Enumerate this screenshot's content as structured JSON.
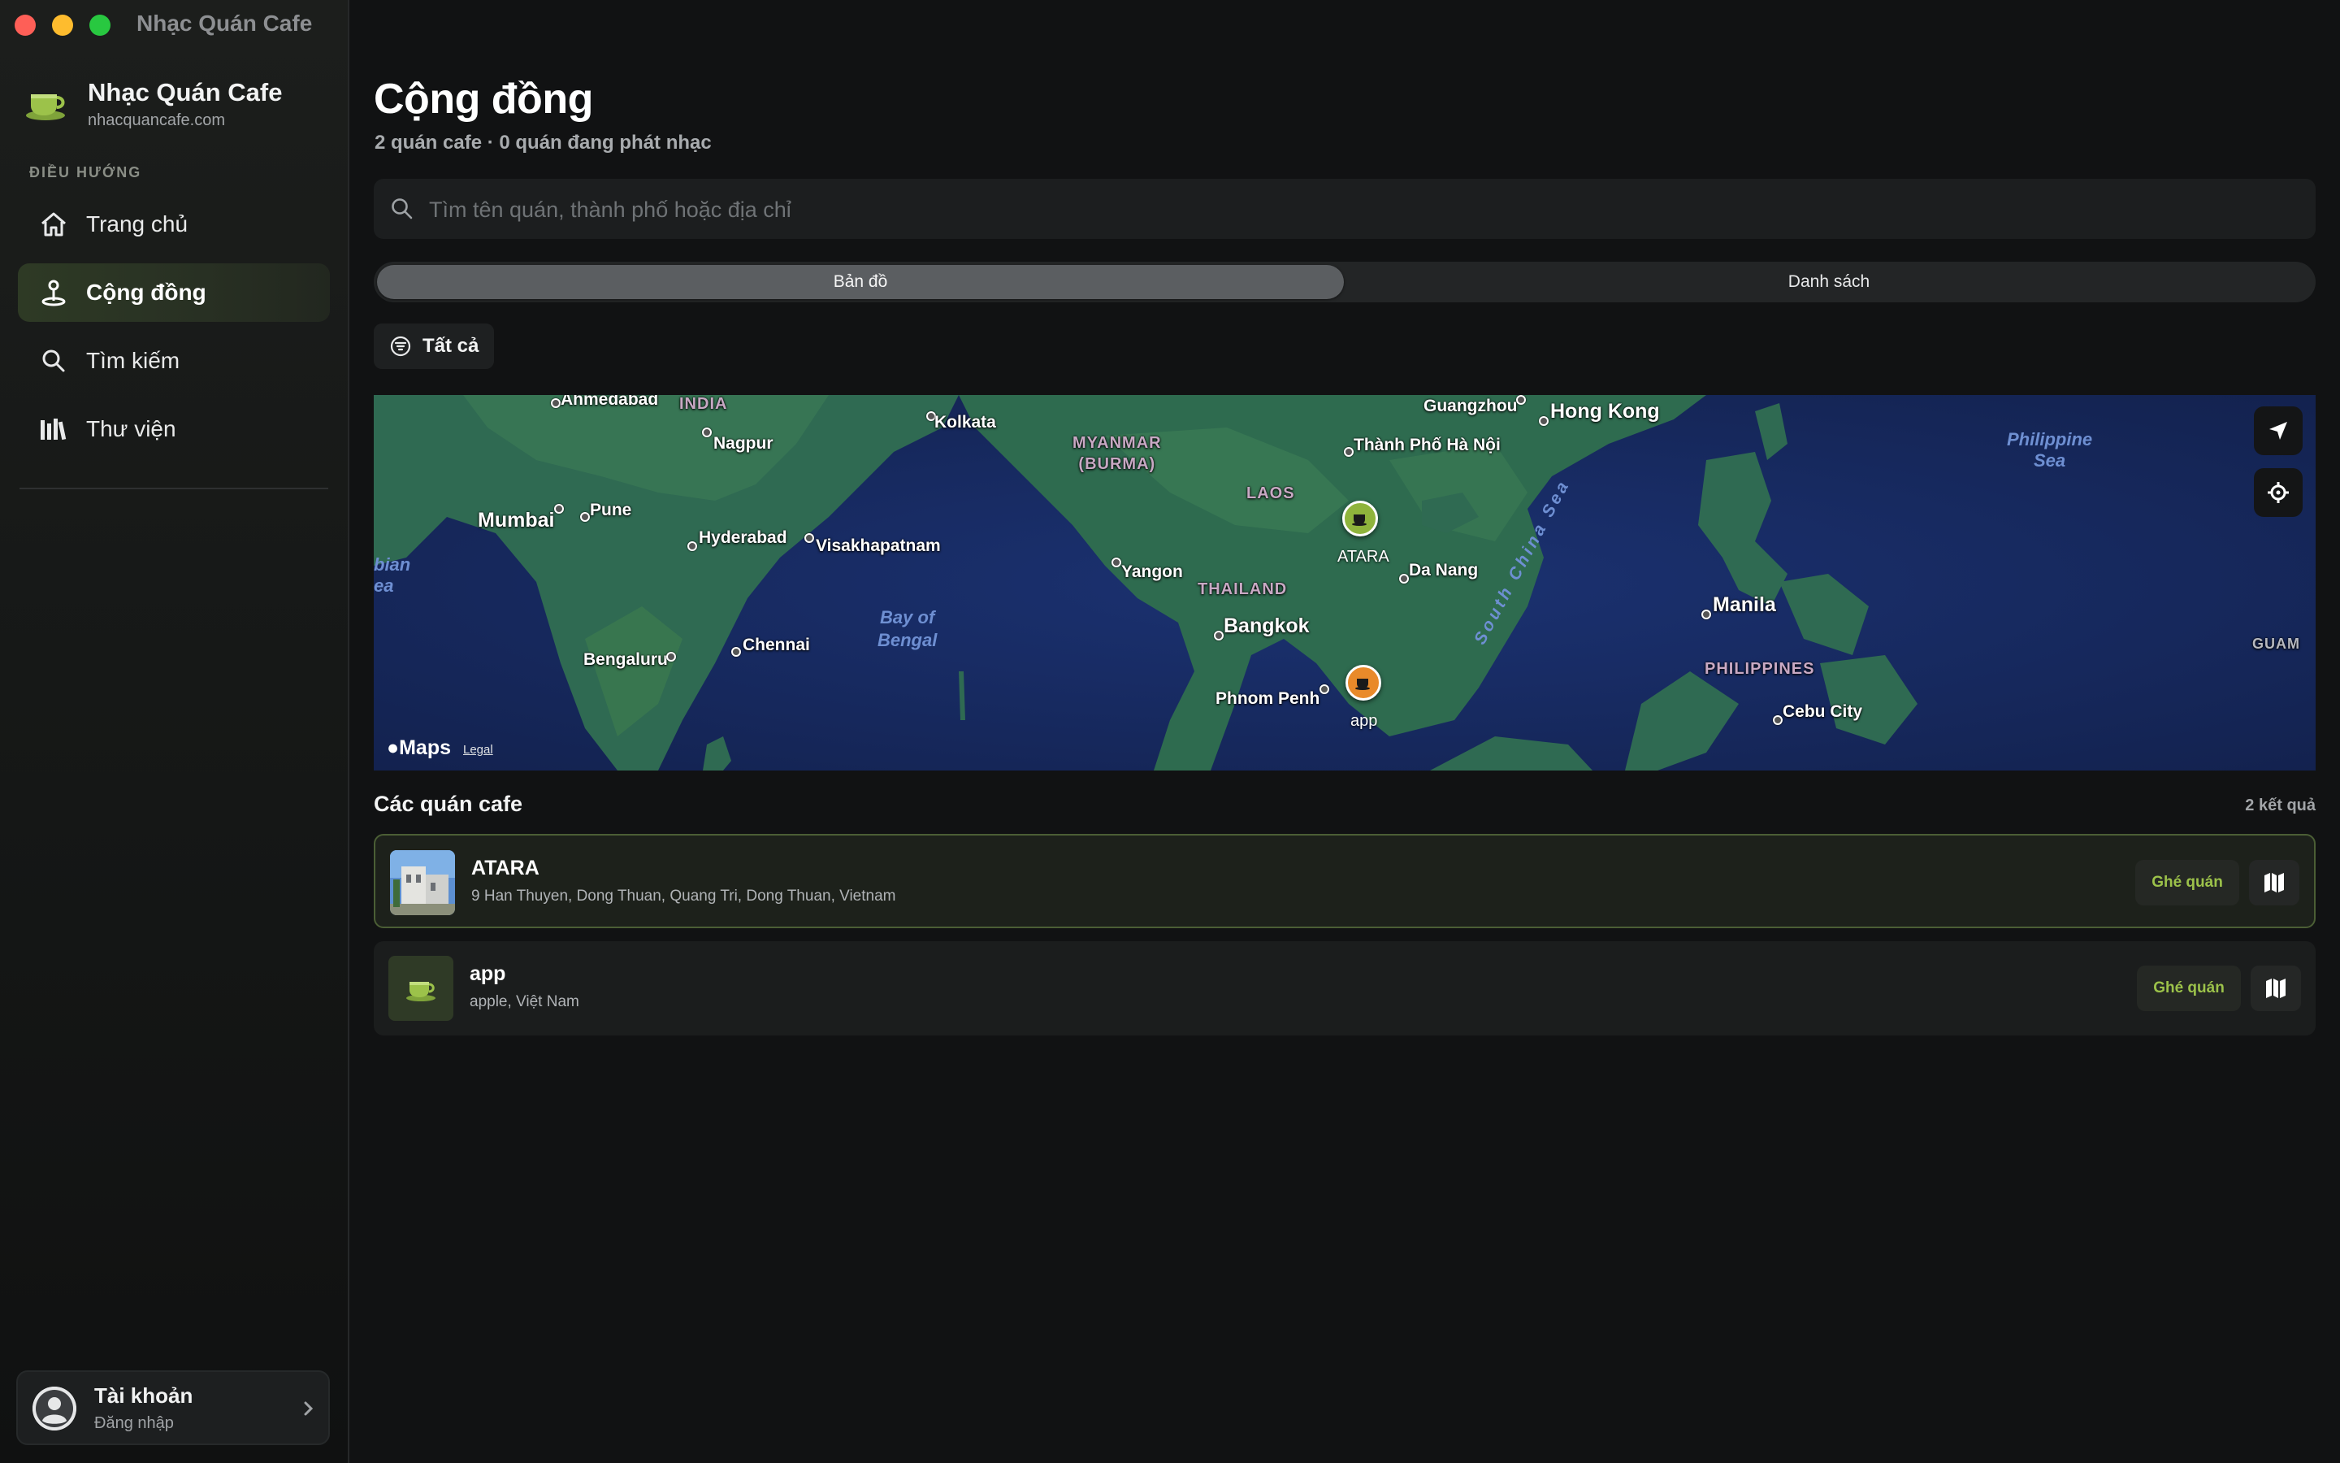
{
  "window": {
    "title": "Nhạc Quán Cafe"
  },
  "sidebar": {
    "brand_name": "Nhạc Quán Cafe",
    "brand_url": "nhacquancafe.com",
    "nav_heading": "ĐIỀU HƯỚNG",
    "items": [
      {
        "label": "Trang chủ",
        "icon": "house-icon",
        "active": false
      },
      {
        "label": "Cộng đồng",
        "icon": "map-pin-icon",
        "active": true
      },
      {
        "label": "Tìm kiếm",
        "icon": "search-icon",
        "active": false
      },
      {
        "label": "Thư viện",
        "icon": "library-icon",
        "active": false
      }
    ],
    "account": {
      "name": "Tài khoản",
      "sub": "Đăng nhập"
    }
  },
  "main": {
    "title": "Cộng đồng",
    "subtitle": "2 quán cafe · 0 quán đang phát nhạc",
    "search_placeholder": "Tìm tên quán, thành phố hoặc địa chỉ",
    "segments": {
      "map": "Bản đồ",
      "list": "Danh sách",
      "selected": "map"
    },
    "filter_label": "Tất cả"
  },
  "map": {
    "provider_label": "Maps",
    "legal_label": "Legal",
    "labels": {
      "ahmedabad": "Ahmedabad",
      "india": "INDIA",
      "kolkata": "Kolkata",
      "nagpur": "Nagpur",
      "mumbai": "Mumbai",
      "pune": "Pune",
      "hyderabad": "Hyderabad",
      "visakhapatnam": "Visakhapatnam",
      "bengaluru": "Bengaluru",
      "chennai": "Chennai",
      "arabian_sea": "bian\nea",
      "bay_of_bengal": "Bay of\nBengal",
      "myanmar": "MYANMAR\n(BURMA)",
      "laos": "LAOS",
      "yangon": "Yangon",
      "thailand": "THAILAND",
      "bangkok": "Bangkok",
      "phnom_penh": "Phnom Penh",
      "guangzhou": "Guangzhou",
      "hong_kong": "Hong Kong",
      "hanoi": "Thành Phố Hà Nội",
      "da_nang": "Da Nang",
      "south_china_sea": "South China Sea",
      "manila": "Manila",
      "philippines": "PHILIPPINES",
      "cebu": "Cebu City",
      "philippine_sea": "Philippine\nSea",
      "guam": "GUAM"
    },
    "pins": [
      {
        "label": "ATARA",
        "color": "#8fb43c"
      },
      {
        "label": "app",
        "color": "#e98a2a"
      }
    ]
  },
  "list": {
    "title": "Các quán cafe",
    "count": "2 kết quả",
    "visit_label": "Ghé quán",
    "rows": [
      {
        "name": "ATARA",
        "address": "9 Han Thuyen, Dong Thuan, Quang Tri, Dong Thuan, Vietnam"
      },
      {
        "name": "app",
        "address": "apple, Việt Nam"
      }
    ]
  },
  "colors": {
    "accent": "#9cc24a",
    "active_nav": "#2e3a25",
    "background": "#111213"
  }
}
